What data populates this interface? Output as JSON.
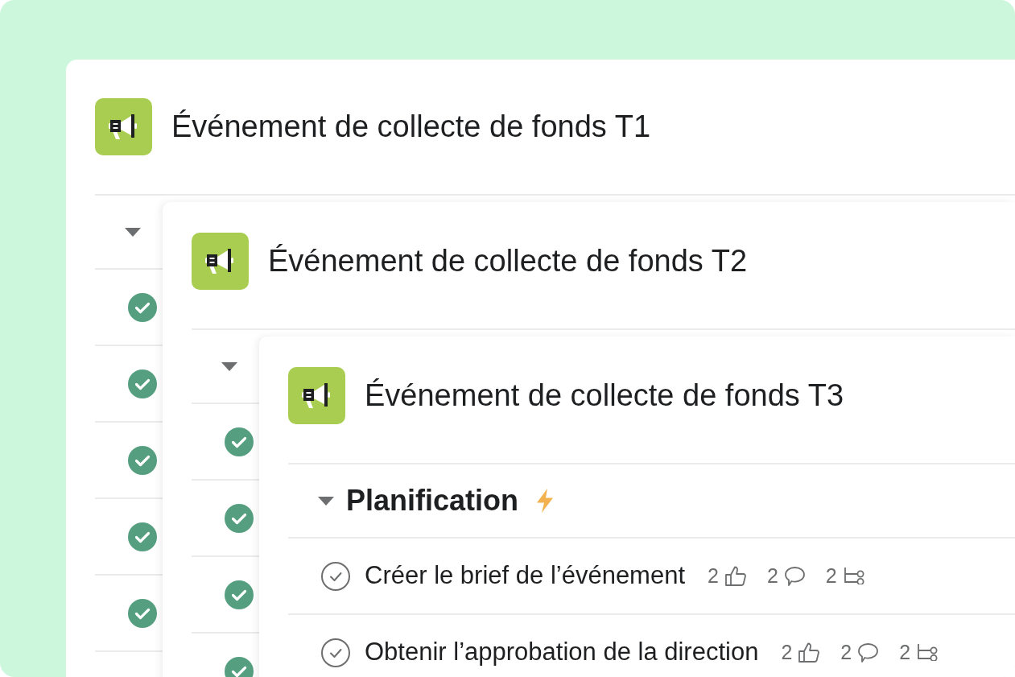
{
  "projects": [
    {
      "title": "Événement de collecte de fonds T1",
      "section": {
        "expanded": true
      },
      "tasks": [
        {
          "completed": true
        },
        {
          "completed": true
        },
        {
          "completed": true
        },
        {
          "completed": true
        },
        {
          "completed": true
        }
      ]
    },
    {
      "title": "Événement de collecte de fonds T2",
      "section": {
        "expanded": true
      },
      "tasks": [
        {
          "completed": true
        },
        {
          "completed": true
        },
        {
          "completed": true
        },
        {
          "completed": true
        }
      ]
    },
    {
      "title": "Événement de collecte de fonds T3",
      "section": {
        "name": "Planification",
        "expanded": true
      },
      "tasks": [
        {
          "name": "Créer le brief de l’événement",
          "completed": false,
          "likes": "2",
          "comments": "2",
          "subtasks": "2"
        },
        {
          "name": "Obtenir l’approbation de la direction",
          "completed": false,
          "likes": "2",
          "comments": "2",
          "subtasks": "2"
        }
      ]
    }
  ]
}
